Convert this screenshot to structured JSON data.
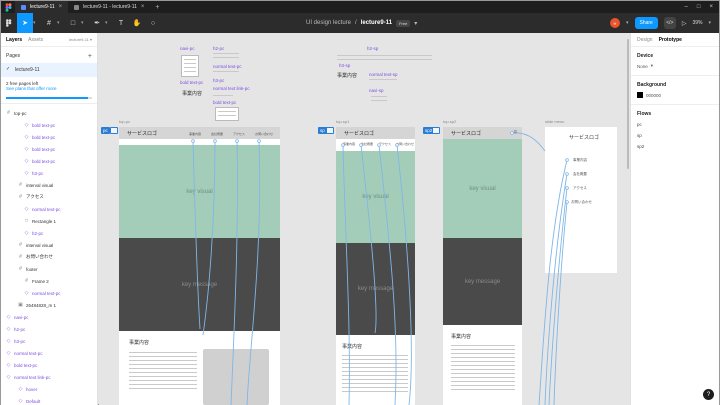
{
  "titlebar": {
    "tabs": [
      {
        "label": "lecture9-11",
        "active": true
      },
      {
        "label": "lecture9-11 - lecture9-11",
        "active": false
      }
    ]
  },
  "toolbar": {
    "project": "UI design lecture",
    "separator": "/",
    "file": "lecture9-11",
    "badge": "Free",
    "avatar": "H",
    "share": "Share",
    "zoom": "39%"
  },
  "left_panel": {
    "tabs": [
      "Layers",
      "Assets"
    ],
    "page_picker": "lecture9-11",
    "pages_title": "Pages",
    "current_page": "lecture9-11",
    "free_note": "2 free pages left",
    "free_link": "See plans that offer more",
    "layers": [
      {
        "label": "top-pc",
        "indent": 0,
        "icon": "frame",
        "purple": false
      },
      {
        "label": "bold text-pc",
        "indent": 3,
        "icon": "component",
        "purple": true
      },
      {
        "label": "bold text-pc",
        "indent": 3,
        "icon": "component",
        "purple": true
      },
      {
        "label": "bold text-pc",
        "indent": 3,
        "icon": "component",
        "purple": true
      },
      {
        "label": "bold text-pc",
        "indent": 3,
        "icon": "component",
        "purple": true
      },
      {
        "label": "h3-pc",
        "indent": 3,
        "icon": "component",
        "purple": true
      },
      {
        "label": "interval visual",
        "indent": 2,
        "icon": "frame",
        "purple": false
      },
      {
        "label": "アクセス",
        "indent": 2,
        "icon": "frame",
        "purple": false
      },
      {
        "label": "normal text-pc",
        "indent": 3,
        "icon": "component",
        "purple": true
      },
      {
        "label": "Rectangle 1",
        "indent": 3,
        "icon": "rect",
        "purple": false
      },
      {
        "label": "h2-pc",
        "indent": 3,
        "icon": "component",
        "purple": true
      },
      {
        "label": "interval visual",
        "indent": 2,
        "icon": "frame",
        "purple": false
      },
      {
        "label": "お問い合わせ",
        "indent": 2,
        "icon": "frame",
        "purple": false
      },
      {
        "label": "footer",
        "indent": 2,
        "icon": "frame",
        "purple": false
      },
      {
        "label": "Frame 2",
        "indent": 3,
        "icon": "frame",
        "purple": false
      },
      {
        "label": "normal text-pc",
        "indent": 3,
        "icon": "component",
        "purple": true
      },
      {
        "label": "26484828_m 1",
        "indent": 2,
        "icon": "image",
        "purple": false
      },
      {
        "label": "navi-pc",
        "indent": 0,
        "icon": "component",
        "purple": true
      },
      {
        "label": "h2-pc",
        "indent": 0,
        "icon": "component",
        "purple": true
      },
      {
        "label": "h3-pc",
        "indent": 0,
        "icon": "component",
        "purple": true
      },
      {
        "label": "normal text-pc",
        "indent": 0,
        "icon": "component",
        "purple": true
      },
      {
        "label": "bold text-pc",
        "indent": 0,
        "icon": "component",
        "purple": true
      },
      {
        "label": "normal text link-pc",
        "indent": 0,
        "icon": "component",
        "purple": true
      },
      {
        "label": "hover",
        "indent": 2,
        "icon": "component",
        "purple": true
      },
      {
        "label": "Default",
        "indent": 2,
        "icon": "component",
        "purple": true
      }
    ]
  },
  "canvas": {
    "components_pc": [
      "navi-pc",
      "h2-pc",
      "normal text-pc",
      "h3-pc",
      "bold text-pc",
      "normal text link-pc"
    ],
    "components_sp": [
      "h2-sp",
      "h3-sp",
      "normal text-sp",
      "navi-sp"
    ],
    "section_title": "事業内容",
    "frames": {
      "pc": {
        "label": "top-pc",
        "tag": "pc",
        "logo": "サービスロゴ",
        "nav": [
          "事業内容",
          "会社概要",
          "アクセス",
          "お問い合わせ"
        ]
      },
      "sp": {
        "label": "top-sp1",
        "tag": "sp",
        "logo": "サービスロゴ",
        "nav": [
          "事業内容",
          "会社概要",
          "アクセス",
          "お問い合わせ"
        ]
      },
      "sp2": {
        "label": "top-sp2",
        "tag": "sp2",
        "logo": "サービスロゴ"
      },
      "menu": {
        "label": "slide menu",
        "logo": "サービスロゴ",
        "items": [
          "事業内容",
          "会社概要",
          "アクセス",
          "お問い合わせ"
        ]
      }
    },
    "key_visual": "key visual",
    "key_message": "key message"
  },
  "right_panel": {
    "tabs": [
      "Design",
      "Prototype"
    ],
    "device_title": "Device",
    "device_value": "None",
    "background_title": "Background",
    "background_value": "000000",
    "flows_title": "Flows",
    "flows": [
      "pc",
      "sp",
      "sp2"
    ]
  },
  "colors": {
    "accent": "#0d99ff",
    "component": "#7b4ee0",
    "key_visual": "#a4cdb9",
    "key_message": "#4a4a4a",
    "wire": "#7fb6e8"
  }
}
